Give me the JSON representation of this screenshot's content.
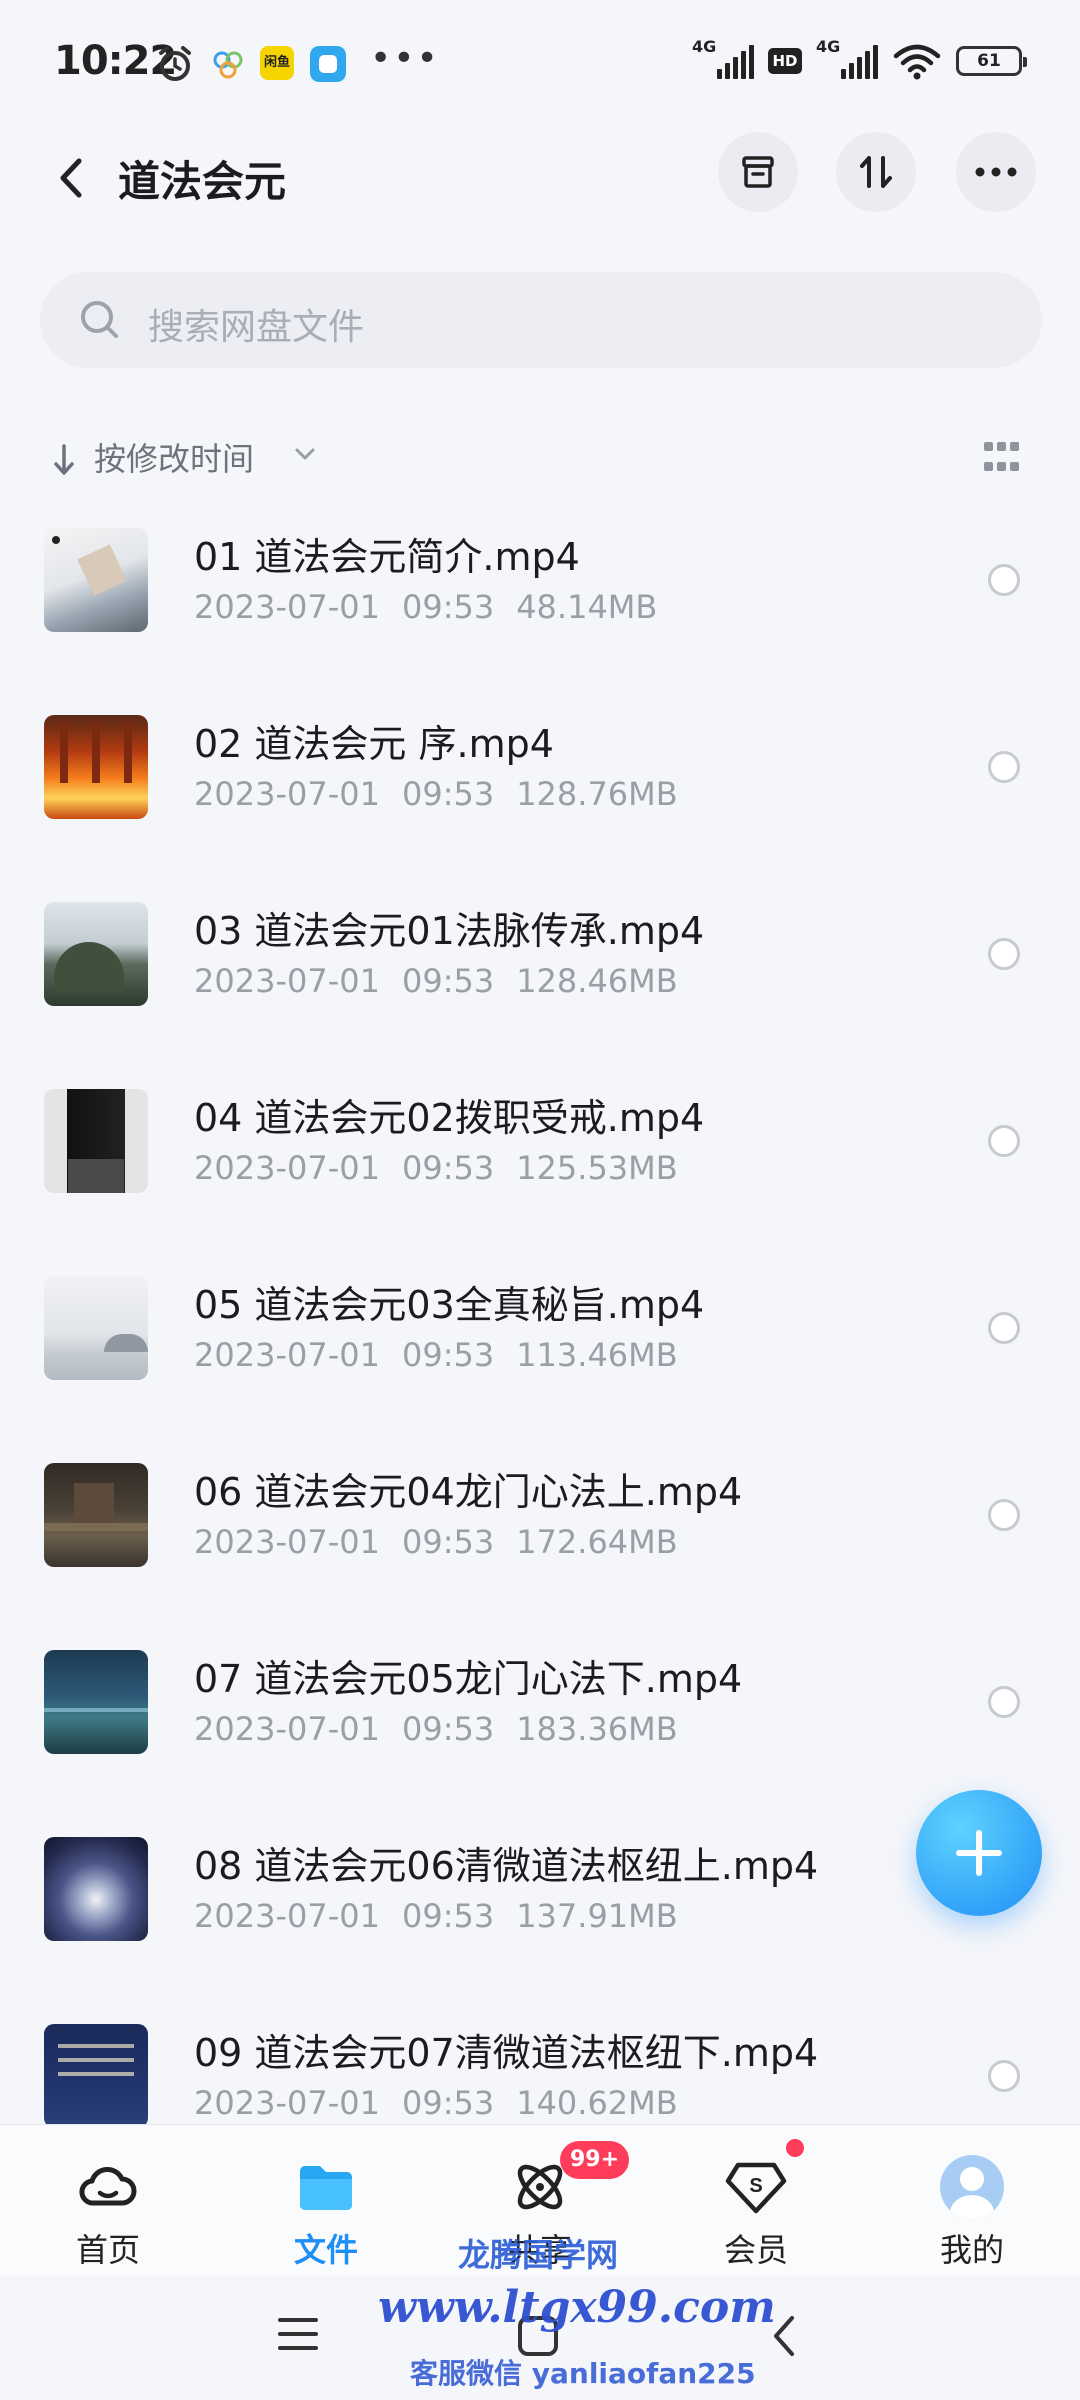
{
  "status_bar": {
    "time": "10:22",
    "signal1_label": "4G",
    "hd_label": "HD",
    "signal2_label": "4G",
    "battery": "61",
    "app2_label": "闲鱼"
  },
  "header": {
    "title": "道法会元"
  },
  "search": {
    "placeholder": "搜索网盘文件"
  },
  "sort": {
    "label": "按修改时间"
  },
  "files": [
    {
      "name": "01 道法会元简介.mp4",
      "date": "2023-07-01",
      "time": "09:53",
      "size": "48.14MB"
    },
    {
      "name": "02 道法会元 序.mp4",
      "date": "2023-07-01",
      "time": "09:53",
      "size": "128.76MB"
    },
    {
      "name": "03 道法会元01法脉传承.mp4",
      "date": "2023-07-01",
      "time": "09:53",
      "size": "128.46MB"
    },
    {
      "name": "04 道法会元02拨职受戒.mp4",
      "date": "2023-07-01",
      "time": "09:53",
      "size": "125.53MB"
    },
    {
      "name": "05 道法会元03全真秘旨.mp4",
      "date": "2023-07-01",
      "time": "09:53",
      "size": "113.46MB"
    },
    {
      "name": "06 道法会元04龙门心法上.mp4",
      "date": "2023-07-01",
      "time": "09:53",
      "size": "172.64MB"
    },
    {
      "name": "07 道法会元05龙门心法下.mp4",
      "date": "2023-07-01",
      "time": "09:53",
      "size": "183.36MB"
    },
    {
      "name": "08 道法会元06清微道法枢纽上.mp4",
      "date": "2023-07-01",
      "time": "09:53",
      "size": "137.91MB"
    },
    {
      "name": "09 道法会元07清微道法枢纽下.mp4",
      "date": "2023-07-01",
      "time": "09:53",
      "size": "140.62MB"
    }
  ],
  "bottom_nav": {
    "home": "首页",
    "files": "文件",
    "share": "共享",
    "share_badge": "99+",
    "vip": "会员",
    "me": "我的"
  },
  "watermark": {
    "line1": "龙腾国学网",
    "line2": "www.ltgx99.com",
    "line3": "客服微信 yanliaofan225"
  },
  "colors": {
    "accent": "#1f8ff5",
    "badge": "#ff3d5a",
    "background": "#f5f6fa"
  }
}
